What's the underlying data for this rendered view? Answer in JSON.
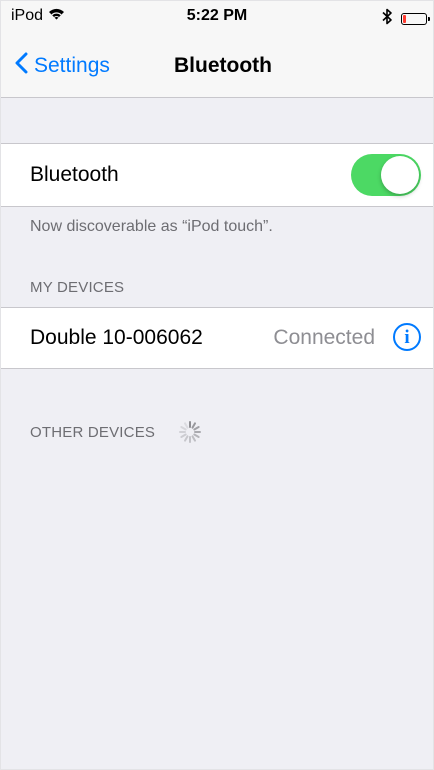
{
  "status_bar": {
    "carrier": "iPod",
    "time": "5:22 PM"
  },
  "nav": {
    "back_label": "Settings",
    "title": "Bluetooth"
  },
  "bluetooth": {
    "label": "Bluetooth",
    "enabled": true,
    "toggle_color": "#4cd964",
    "discoverable_text": "Now discoverable as “iPod touch”."
  },
  "my_devices": {
    "header": "MY DEVICES",
    "items": [
      {
        "name": "Double 10-006062",
        "status": "Connected"
      }
    ]
  },
  "other_devices": {
    "header": "OTHER DEVICES"
  },
  "accent_color": "#007aff",
  "battery": {
    "level_color": "#ff3b30"
  }
}
